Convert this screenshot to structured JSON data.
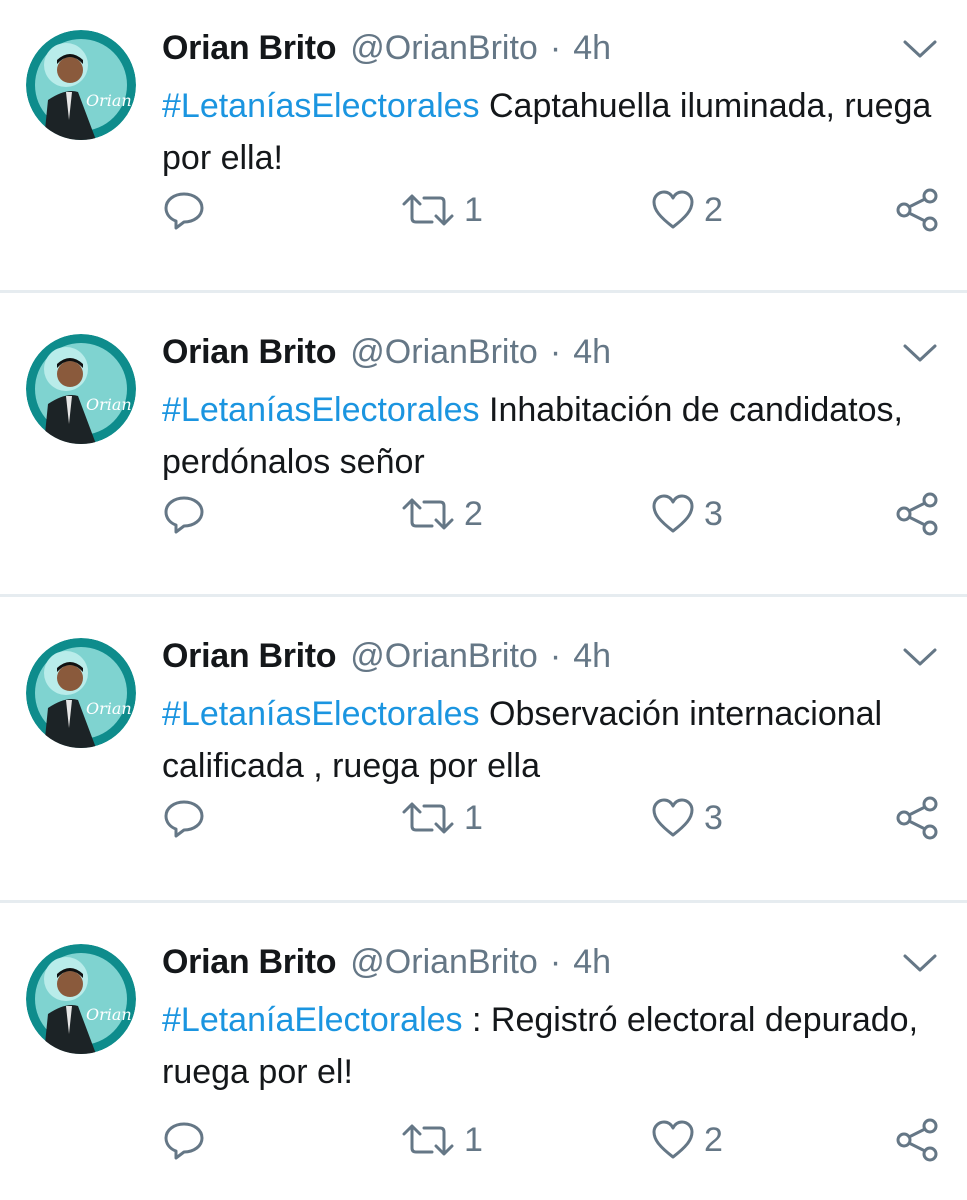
{
  "accent_color": "#1b95e0",
  "secondary_text_color": "#657786",
  "tweets": [
    {
      "author_name": "Orian Brito",
      "author_handle": "@OrianBrito",
      "separator": "·",
      "time": "4h",
      "hashtag": "#LetaníasElectorales",
      "text": " Captahuella iluminada, ruega por ella!",
      "retweets": "1",
      "likes": "2"
    },
    {
      "author_name": "Orian Brito",
      "author_handle": "@OrianBrito",
      "separator": "·",
      "time": "4h",
      "hashtag": "#LetaníasElectorales",
      "text": " Inhabitación de candidatos, perdónalos señor",
      "retweets": "2",
      "likes": "3"
    },
    {
      "author_name": "Orian Brito",
      "author_handle": "@OrianBrito",
      "separator": "·",
      "time": "4h",
      "hashtag": "#LetaníasElectorales",
      "text": " Observación internacional calificada , ruega por ella",
      "retweets": "1",
      "likes": "3"
    },
    {
      "author_name": "Orian Brito",
      "author_handle": "@OrianBrito",
      "separator": "·",
      "time": "4h",
      "hashtag": "#LetaníaElectorales",
      "text": " : Registró electoral depurado, ruega por el!",
      "retweets": "1",
      "likes": "2"
    }
  ],
  "icons": {
    "reply": "reply-icon",
    "retweet": "retweet-icon",
    "like": "heart-icon",
    "share": "share-icon",
    "caret": "chevron-down-icon"
  }
}
